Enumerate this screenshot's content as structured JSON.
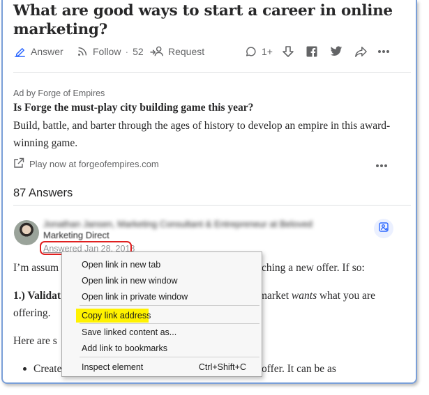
{
  "question": {
    "title": "What are good ways to start a career in online marketing?"
  },
  "actions": {
    "answer_label": "Answer",
    "follow_label": "Follow",
    "follow_sep": "·",
    "follow_count": "52",
    "request_label": "Request",
    "comments_count": "1+"
  },
  "ad": {
    "by": "Ad by Forge of Empires",
    "title": "Is Forge the must-play city building game this year?",
    "body": "Build, battle, and barter through the ages of history to develop an empire in this award-winning game.",
    "link": "Play now at forgeofempires.com"
  },
  "answers_count": "87 Answers",
  "answer": {
    "author_name_blurred": "Jonathan Jansen, Marketing Consultant & Entrepreneur at Beloved",
    "author_sub": "Marketing Direct",
    "answered_date": "Answered Jan 28, 2018",
    "line1_start": "I’m assum",
    "line1_end": "ching a new offer. If so:",
    "line2_start_bold": "1.) Validat",
    "line2_end_a": "market ",
    "line2_end_italic": "wants",
    "line2_end_b": " what you are",
    "line3": "offering.",
    "line4": "Here are s",
    "bullet_start": "Create",
    "bullet_end": "offer. It can be as"
  },
  "context_menu": {
    "items": [
      "Open link in new tab",
      "Open link in new window",
      "Open link in private window",
      "Copy link address",
      "Save linked content as...",
      "Add link to bookmarks",
      "Inspect element"
    ],
    "inspect_shortcut": "Ctrl+Shift+C",
    "highlight_color": "#fff200"
  },
  "colors": {
    "accent_blue": "#2e69ff",
    "text_primary": "#282829",
    "text_secondary": "#636466",
    "annotation_red": "#e02020",
    "frame_border": "#7a9fd8"
  }
}
